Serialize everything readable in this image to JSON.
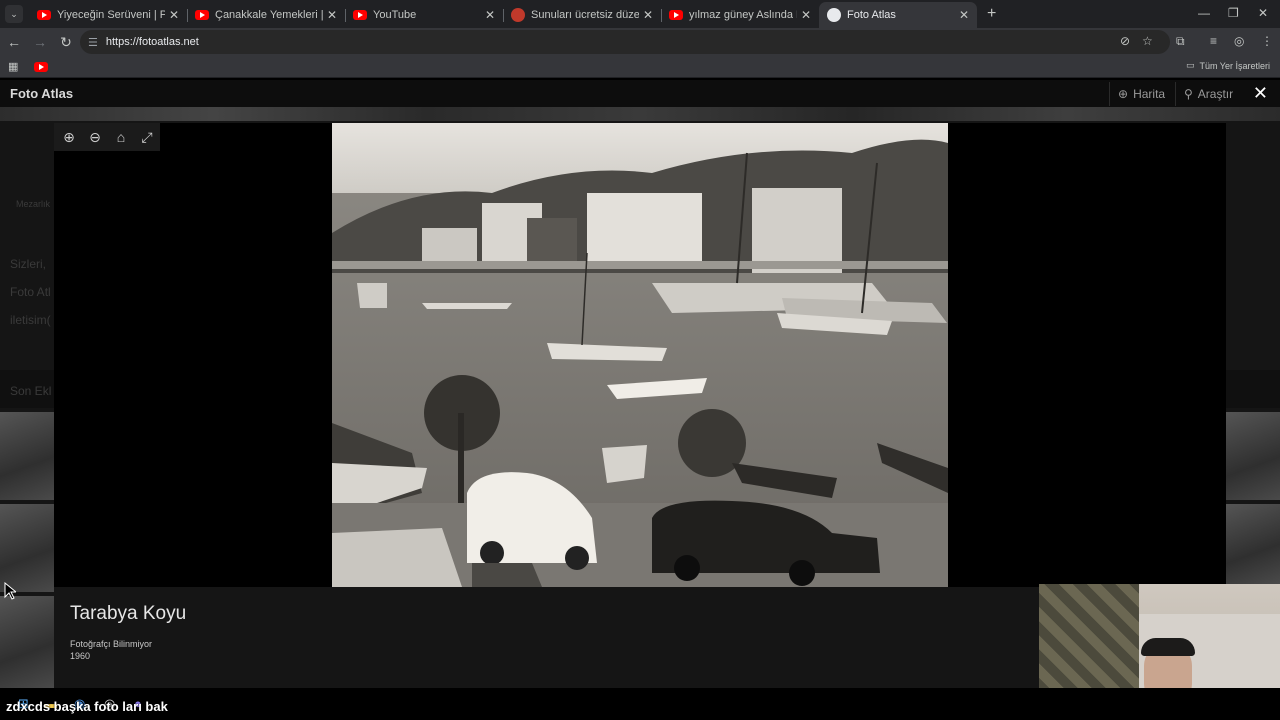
{
  "browser": {
    "tabs": [
      {
        "title": "Yiyeceğin Serüveni | Pişmaniye",
        "favicon": "youtube-icon",
        "active": false
      },
      {
        "title": "Çanakkale Yemekleri | Meşhur Y",
        "favicon": "youtube-icon",
        "active": false
      },
      {
        "title": "YouTube",
        "favicon": "youtube-icon",
        "active": false
      },
      {
        "title": "Sunuları ücretsiz düzenleyin | W",
        "favicon": "presentation-icon",
        "active": false
      },
      {
        "title": "yılmaz güney Aslında Kimdi? | Y",
        "favicon": "youtube-icon",
        "active": false
      },
      {
        "title": "Foto Atlas",
        "favicon": "globe-icon",
        "active": true
      }
    ],
    "url": "https://fotoatlas.net",
    "bookmarks_all_label": "Tüm Yer İşaretleri"
  },
  "site": {
    "logo": "Foto Atlas",
    "nav": {
      "map_label": "Harita",
      "search_label": "Araştır"
    },
    "background": {
      "cemetery_label": "Mezarlık",
      "text_lines": [
        "Sizleri,",
        "Foto Atl",
        "iletisim("
      ],
      "recent_label": "Son Ekl"
    }
  },
  "viewer": {
    "photo_title": "Tarabya Koyu",
    "photographer": "Fotoğrafçı Bilinmiyor",
    "year": "1960"
  },
  "overlay": {
    "text": "zdxcds  başka foto ları bak"
  },
  "colors": {
    "tab_bg": "#202124",
    "toolbar_bg": "#35363a",
    "page_bg": "#151515",
    "youtube_red": "#ff0000"
  }
}
